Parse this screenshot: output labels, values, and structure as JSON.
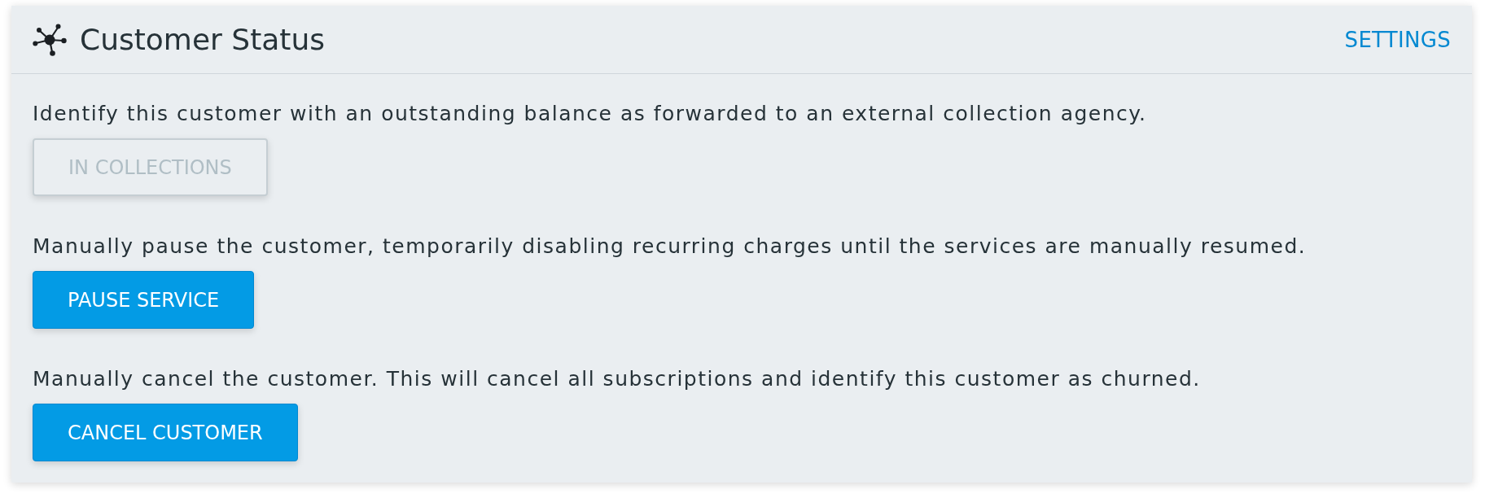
{
  "header": {
    "title": "Customer Status",
    "settings_link": "SETTINGS"
  },
  "actions": [
    {
      "description": "Identify this customer with an outstanding balance as forwarded to an external collection agency.",
      "button": "IN COLLECTIONS",
      "disabled": true
    },
    {
      "description": "Manually pause the customer, temporarily disabling recurring charges until the services are manually resumed.",
      "button": "PAUSE SERVICE",
      "disabled": false
    },
    {
      "description": "Manually cancel the customer. This will cancel all subscriptions and identify this customer as churned.",
      "button": "CANCEL CUSTOMER",
      "disabled": false
    }
  ]
}
